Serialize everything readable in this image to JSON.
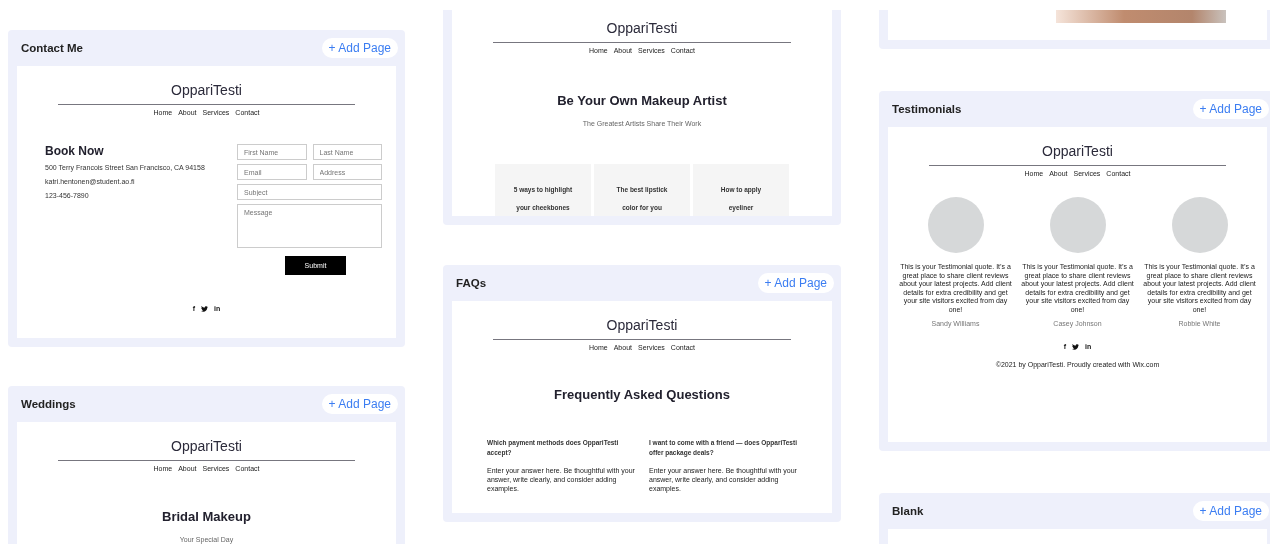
{
  "columns": [
    {
      "cards": [
        {
          "title": "Contact Me",
          "add_button": "+ Add Page",
          "preview": {
            "kind": "contact",
            "site_name": "OppariTesti",
            "nav": [
              "Home",
              "About",
              "Services",
              "Contact"
            ],
            "heading": "Book Now",
            "info": [
              "500 Terry Francois Street San Francisco, CA 94158",
              "katri.hentonen@student.ao.fi",
              "123-456-7890"
            ],
            "fields": [
              {
                "placeholder": "First Name",
                "kind": "half"
              },
              {
                "placeholder": "Last Name",
                "kind": "half"
              },
              {
                "placeholder": "Email",
                "kind": "half"
              },
              {
                "placeholder": "Address",
                "kind": "half"
              },
              {
                "placeholder": "Subject",
                "kind": "full"
              },
              {
                "placeholder": "Message",
                "kind": "area"
              }
            ],
            "submit": "Submit",
            "social": [
              {
                "kind": "facebook",
                "glyph": "f"
              },
              {
                "kind": "twitter"
              },
              {
                "kind": "linkedin",
                "glyph": "in"
              }
            ]
          }
        },
        {
          "title": "Weddings",
          "add_button": "+ Add Page",
          "preview": {
            "kind": "landing",
            "site_name": "OppariTesti",
            "nav": [
              "Home",
              "About",
              "Services",
              "Contact"
            ],
            "heading": "Bridal Makeup",
            "subtitle": "Your Special Day"
          }
        }
      ]
    },
    {
      "cards": [
        {
          "preview": {
            "kind": "blog",
            "site_name": "OppariTesti",
            "nav": [
              "Home",
              "About",
              "Services",
              "Contact"
            ],
            "heading": "Be Your Own Makeup Artist",
            "subtitle": "The Greatest Artists Share Their Work",
            "posts": [
              "5 ways to highlight your cheekbones",
              "The best lipstick color for you",
              "How to apply eyeliner"
            ]
          }
        },
        {
          "title": "FAQs",
          "add_button": "+ Add Page",
          "preview": {
            "kind": "faq",
            "site_name": "OppariTesti",
            "nav": [
              "Home",
              "About",
              "Services",
              "Contact"
            ],
            "heading": "Frequently Asked Questions",
            "questions": [
              {
                "question": "Which payment methods does OppariTesti accept?",
                "answer": "Enter your answer here. Be thoughtful with your answer, write clearly, and consider adding examples."
              },
              {
                "question": "I want to come with a friend — does OppariTesti offer package deals?",
                "answer": "Enter your answer here. Be thoughtful with your answer, write clearly, and consider adding examples."
              }
            ]
          }
        }
      ]
    },
    {
      "cards": [
        {
          "preview": {
            "kind": "photo"
          }
        },
        {
          "title": "Testimonials",
          "add_button": "+ Add Page",
          "preview": {
            "kind": "testimonials",
            "site_name": "OppariTesti",
            "nav": [
              "Home",
              "About",
              "Services",
              "Contact"
            ],
            "items": [
              {
                "quote": "This is your Testimonial quote. It’s a great place to share client reviews about your latest projects. Add client details for extra credibility and get your site visitors excited from day one!",
                "name": "Sandy Williams"
              },
              {
                "quote": "This is your Testimonial quote. It’s a great place to share client reviews about your latest projects. Add client details for extra credibility and get your site visitors excited from day one!",
                "name": "Casey Johnson"
              },
              {
                "quote": "This is your Testimonial quote. It’s a great place to share client reviews about your latest projects. Add client details for extra credibility and get your site visitors excited from day one!",
                "name": "Robbie White"
              }
            ],
            "social": [
              {
                "kind": "facebook",
                "glyph": "f"
              },
              {
                "kind": "twitter"
              },
              {
                "kind": "linkedin",
                "glyph": "in"
              }
            ],
            "footer": "©2021 by OppariTesti. Proudly created with Wix.com"
          }
        },
        {
          "title": "Blank",
          "add_button": "+ Add Page",
          "preview": {
            "kind": "blank"
          }
        }
      ]
    }
  ]
}
